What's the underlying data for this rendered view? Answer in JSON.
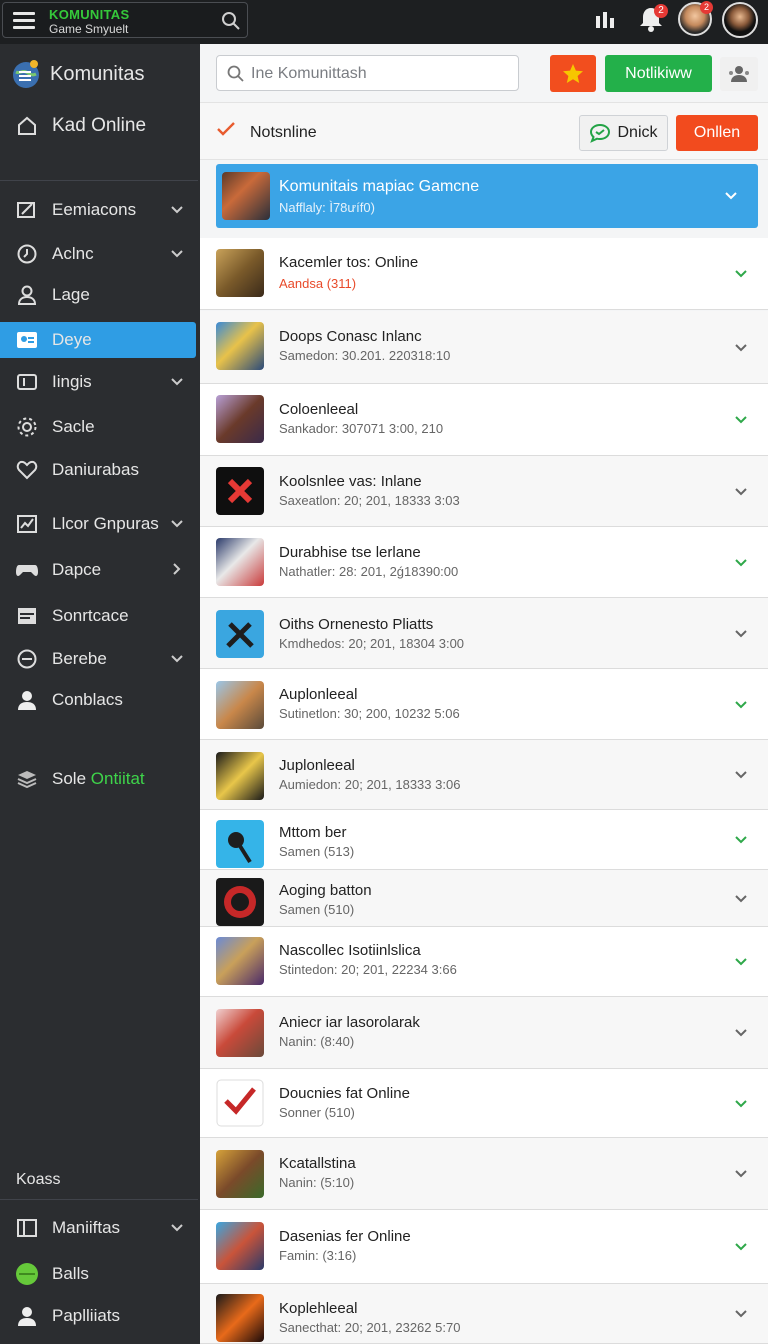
{
  "brand": {
    "title": "KOMUNITAS",
    "subtitle": "Game Smyuelt"
  },
  "top_icons": {
    "notif_badge": "2",
    "avatar_badge": "2"
  },
  "sidebar": {
    "header": "Komunitas",
    "top_item": "Kad Online",
    "items": [
      {
        "label": "Eemiacons",
        "icon": "edit-icon",
        "chevron": true
      },
      {
        "label": "Aclnc",
        "icon": "clock-icon",
        "chevron": true
      },
      {
        "label": "Lage",
        "icon": "user-icon",
        "chevron": false
      },
      {
        "label": "Deye",
        "icon": "id-card-icon",
        "chevron": false,
        "active": true
      },
      {
        "label": "Iingis",
        "icon": "panel-icon",
        "chevron": true
      },
      {
        "label": "Sacle",
        "icon": "gear-icon",
        "chevron": false
      },
      {
        "label": "Daniurabas",
        "icon": "heart-icon",
        "chevron": false
      },
      {
        "label": "Llcor Gnpuras",
        "icon": "chart-icon",
        "chevron": true
      },
      {
        "label": "Dapce",
        "icon": "gamepad-icon",
        "chevron": true
      },
      {
        "label": "Sonrtcace",
        "icon": "window-icon",
        "chevron": false
      },
      {
        "label": "Berebe",
        "icon": "refresh-icon",
        "chevron": true
      },
      {
        "label": "Conblacs",
        "icon": "person-icon",
        "chevron": false
      }
    ],
    "sole_label": "Sole",
    "sole_green": "Ontiitat",
    "section_label": "Koass",
    "bottom_items": [
      {
        "label": "Maniiftas",
        "icon": "grid-icon",
        "chevron": true
      },
      {
        "label": "Balls",
        "icon": "ball-icon",
        "chevron": false
      },
      {
        "label": "Paplliiats",
        "icon": "person-icon",
        "chevron": false
      }
    ]
  },
  "search": {
    "placeholder": "Ine Komunittash"
  },
  "toolbar": {
    "notify_label": "Notlikiww"
  },
  "subheader": {
    "title": "Notsnline",
    "dnick_label": "Dnick",
    "onllen_label": "Onllen"
  },
  "list": [
    {
      "title": "Komunitais mapiac Gamcne",
      "sub": "Nafflaly: Ì78ưíf0)",
      "featured": true,
      "thumb": "soldier"
    },
    {
      "title": "Kacemler tos: Online",
      "sub": "Aandsa (311)",
      "sub_red": true,
      "thumb": "desert"
    },
    {
      "title": "Doops Conasc Inlanc",
      "sub": "Samedon: 30.201. 220318:10",
      "thumb": "robot"
    },
    {
      "title": "Coloenleeal",
      "sub": "Sankador: 307071 3:00, 210",
      "thumb": "warrior"
    },
    {
      "title": "Koolsnlee vas: Inlane",
      "sub": "Saxeatlon: 20; 201, 18333 3:03",
      "thumb": "xmark"
    },
    {
      "title": "Durabhise tse lerlane",
      "sub": "Nathatler: 28: 201, 2ǵ18390:00",
      "thumb": "crew"
    },
    {
      "title": "Oiths Ornenesto Pliatts",
      "sub": "Kmdhedos: 20; 201, 18304 3:00",
      "thumb": "tools"
    },
    {
      "title": "Auplonleeal",
      "sub": "Sutinetlon: 30; 200, 10232 5:06",
      "thumb": "squad"
    },
    {
      "title": "Juplonleeal",
      "sub": "Aumiedon: 20; 201, 18333 3:06",
      "thumb": "mech"
    },
    {
      "title": "Mttom ber",
      "sub": "Samen (513)",
      "thumb": "mic"
    },
    {
      "title": "Aoging batton",
      "sub": "Samen (510)",
      "thumb": "disc"
    },
    {
      "title": "Nascollec Isotiinlslica",
      "sub": "Stintedon: 20; 201, 22234 3:66",
      "thumb": "knight"
    },
    {
      "title": "Aniecr iar lasorolarak",
      "sub": "Nanin: (8:40)",
      "thumb": "street"
    },
    {
      "title": "Doucnies fat Online",
      "sub": "Sonner (510)",
      "thumb": "check"
    },
    {
      "title": "Kcatallstina",
      "sub": "Nanin: (5:10)",
      "thumb": "desert2"
    },
    {
      "title": "Dasenias fer Online",
      "sub": "Famin: (3:16)",
      "thumb": "hero"
    },
    {
      "title": "Koplehleeal",
      "sub": "Sanecthat: 20; 201, 23262 5:70",
      "thumb": "fire"
    }
  ],
  "colors": {
    "accent_blue": "#3ba4e6",
    "active_blue": "#2f9de4",
    "green": "#23b04a",
    "orange": "#f24b1e",
    "sidebar_bg": "#2b2d30"
  }
}
